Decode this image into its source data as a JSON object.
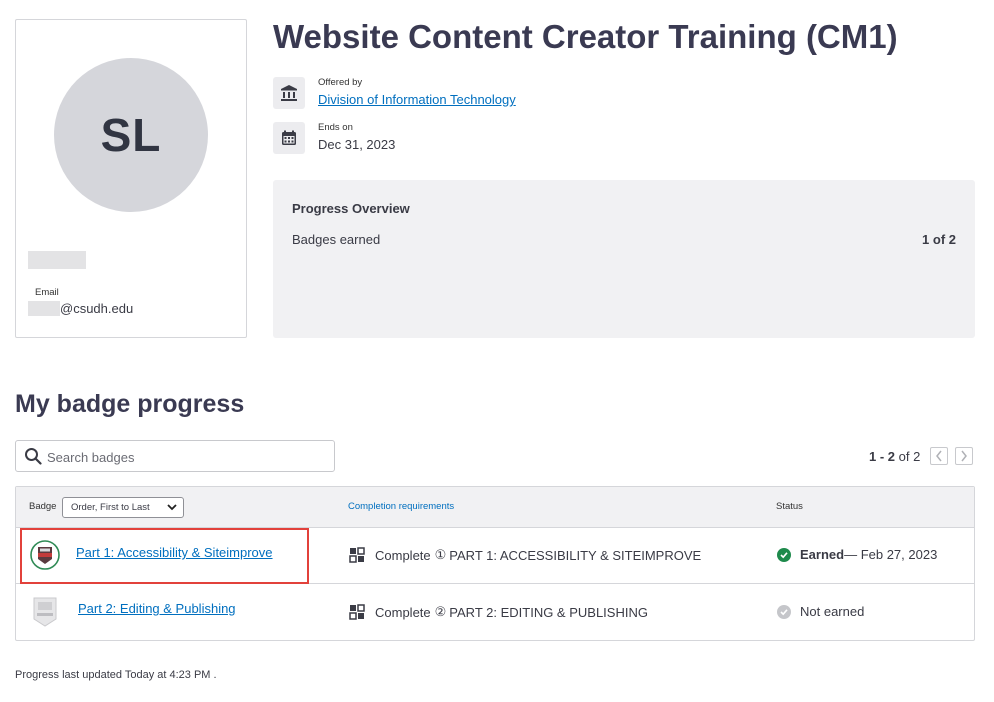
{
  "profile": {
    "initials": "SL",
    "email_label": "Email",
    "email_domain": "@csudh.edu"
  },
  "course": {
    "title": "Website Content Creator Training (CM1)",
    "offered_by_label": "Offered by",
    "offered_by": "Division of Information Technology",
    "ends_on_label": "Ends on",
    "ends_on": "Dec 31, 2023"
  },
  "progress_overview": {
    "title": "Progress Overview",
    "badges_label": "Badges earned",
    "badges_count": "1 of 2"
  },
  "badges_section": {
    "heading": "My badge progress",
    "search_placeholder": "Search badges",
    "pager_range": "1 - 2",
    "pager_of": " of 2",
    "columns": {
      "badge": "Badge",
      "sort_option": "Order, First to Last",
      "requirements": "Completion requirements",
      "status": "Status"
    },
    "rows": [
      {
        "name": "Part 1: Accessibility & Siteimprove",
        "req_prefix": "Complete",
        "req_num": "①",
        "req_text": "PART 1: ACCESSIBILITY & SITEIMPROVE",
        "status_label": "Earned",
        "status_date": " — Feb 27, 2023",
        "status_color": "#1e8a4c"
      },
      {
        "name": "Part 2: Editing & Publishing",
        "req_prefix": "Complete",
        "req_num": "②",
        "req_text": "PART 2: EDITING & PUBLISHING",
        "status_label": "Not earned",
        "status_date": "",
        "status_color": "#c5c6ca"
      }
    ]
  },
  "footer": {
    "note": "Progress last updated Today at 4:23 PM ."
  },
  "colors": {
    "link": "#006fbf",
    "highlight": "#e2413b",
    "panel": "#f1f1f3"
  }
}
